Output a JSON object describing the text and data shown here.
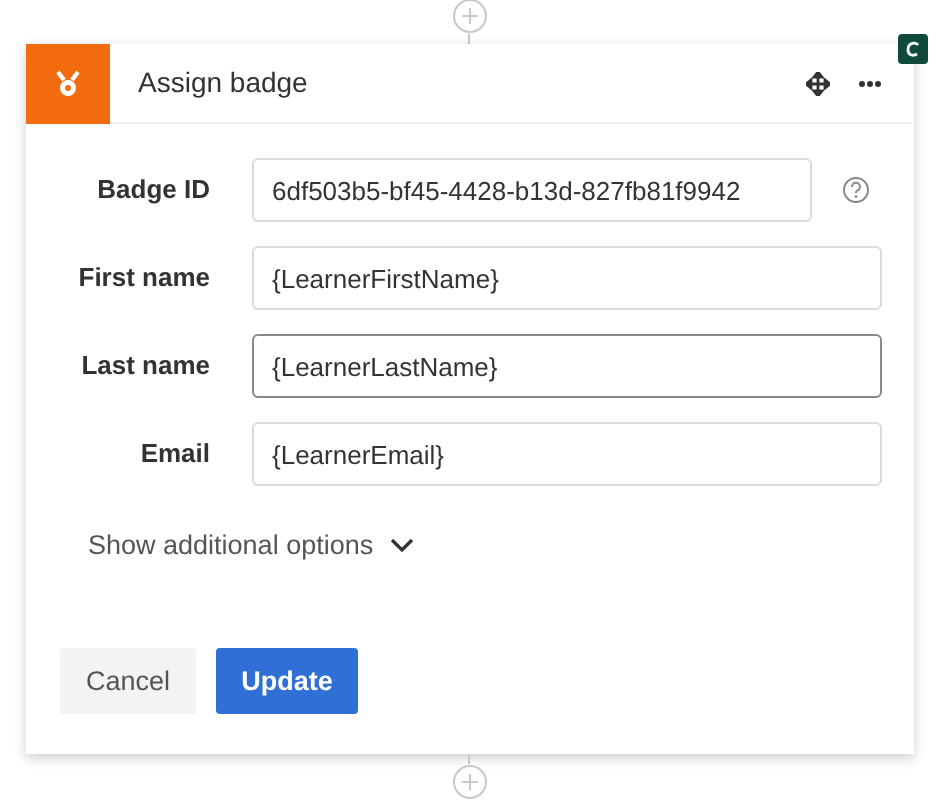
{
  "card": {
    "title": "Assign badge"
  },
  "fields": [
    {
      "label": "Badge ID",
      "value": "6df503b5-bf45-4428-b13d-827fb81f9942",
      "help": true,
      "focused": false
    },
    {
      "label": "First name",
      "value": "{LearnerFirstName}",
      "help": false,
      "focused": false
    },
    {
      "label": "Last name",
      "value": "{LearnerLastName}",
      "help": false,
      "focused": true
    },
    {
      "label": "Email",
      "value": "{LearnerEmail}",
      "help": false,
      "focused": false
    }
  ],
  "more_options": {
    "label": "Show additional options",
    "expanded": false
  },
  "buttons": [
    {
      "label": "Cancel",
      "kind": "secondary"
    },
    {
      "label": "Update",
      "kind": "primary"
    }
  ]
}
